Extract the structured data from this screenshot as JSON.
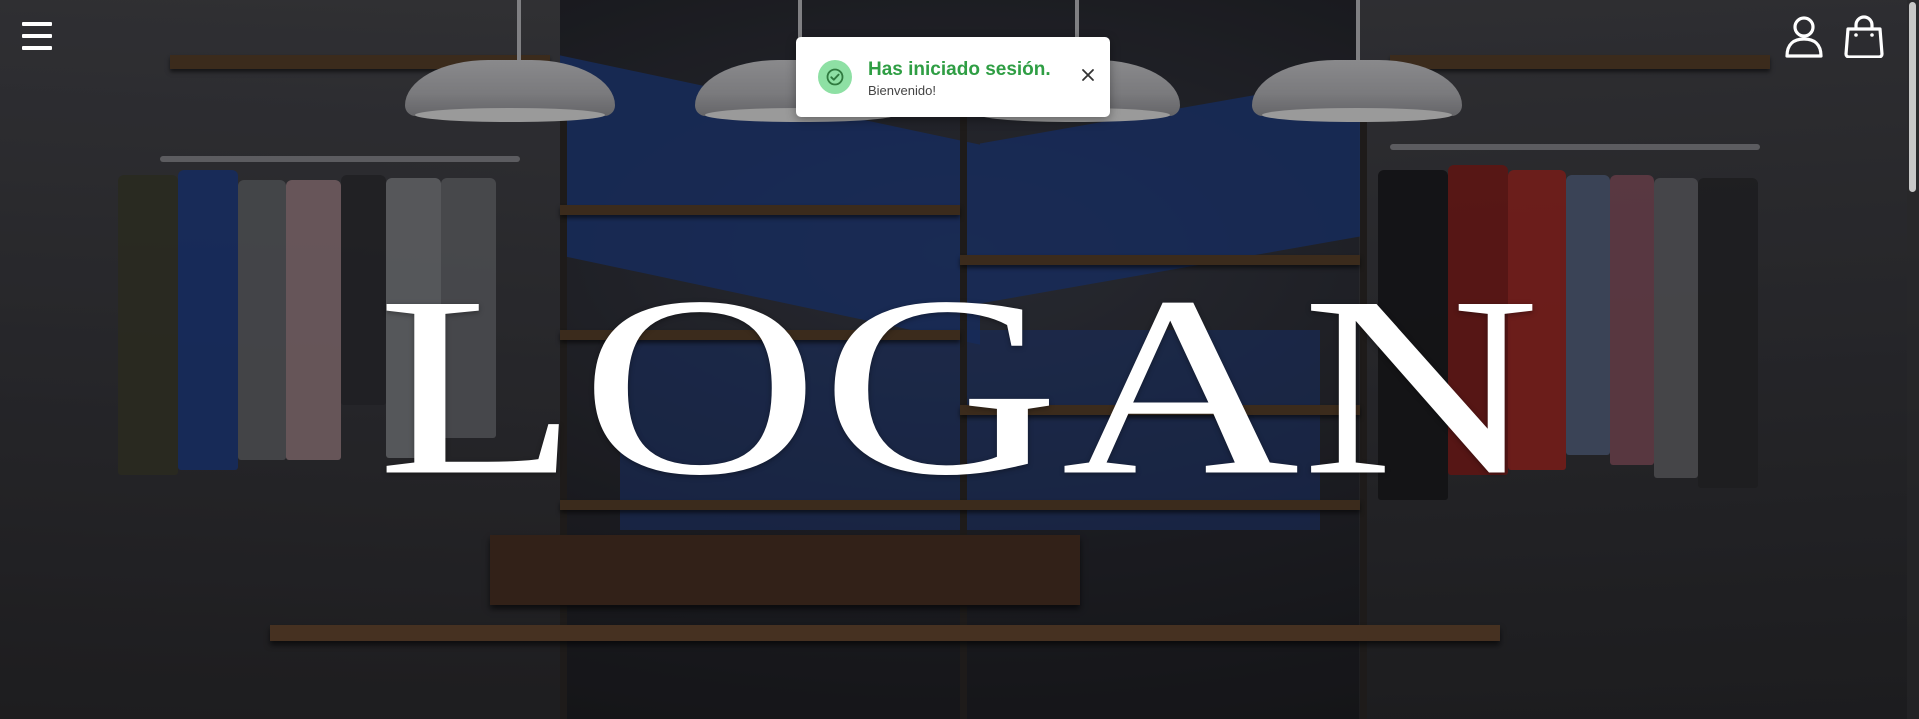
{
  "brand": {
    "wordmark": "LOGAN",
    "color": "#ffffff"
  },
  "header": {
    "menu_icon": "hamburger-menu-icon",
    "account_icon": "user-icon",
    "cart_icon": "shopping-bag-icon"
  },
  "toast": {
    "title": "Has iniciado sesión.",
    "message": "Bienvenido!",
    "status_icon": "check-circle-icon",
    "close_icon": "close-icon",
    "accent_color": "#2f9e44",
    "icon_bg_color": "#8ee0a4"
  }
}
